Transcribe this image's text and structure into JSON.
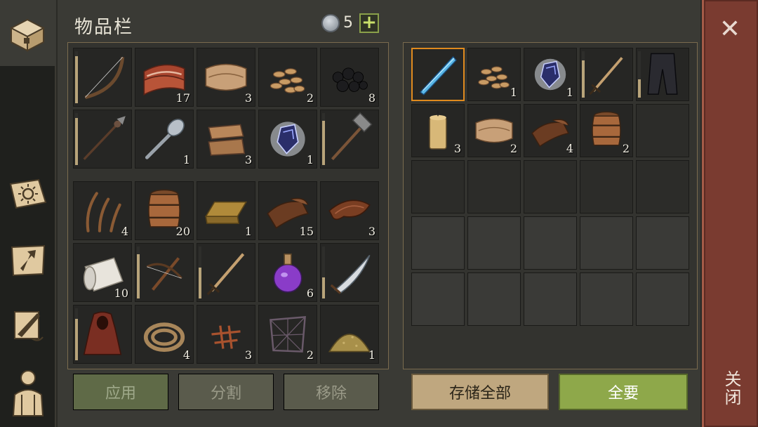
{
  "header": {
    "title": "物品栏",
    "currency_count": "5",
    "add_label": "+"
  },
  "sidebar": {
    "tabs": [
      {
        "name": "inventory",
        "icon": "chest-icon",
        "active": true
      },
      {
        "name": "daily",
        "icon": "sun-book-icon"
      },
      {
        "name": "build",
        "icon": "hammer-map-icon"
      },
      {
        "name": "quests",
        "icon": "scroll-quill-icon"
      },
      {
        "name": "character",
        "icon": "character-icon"
      }
    ]
  },
  "inventory": {
    "equipped": [
      {
        "item": "bow",
        "count": "",
        "durability": 0.9
      },
      {
        "item": "meat",
        "count": "17"
      },
      {
        "item": "cloth",
        "count": "3"
      },
      {
        "item": "seeds",
        "count": "2"
      },
      {
        "item": "coal",
        "count": "8"
      },
      {
        "item": "spear",
        "count": "",
        "durability": 0.9
      },
      {
        "item": "spoon",
        "count": "1"
      },
      {
        "item": "fabric-scraps",
        "count": "3"
      },
      {
        "item": "crystal",
        "count": "1"
      },
      {
        "item": "hammer",
        "count": "",
        "durability": 0.85
      }
    ],
    "bag": [
      {
        "item": "fiber",
        "count": "4"
      },
      {
        "item": "barrel",
        "count": "20"
      },
      {
        "item": "ingot",
        "count": "1"
      },
      {
        "item": "leather",
        "count": "15"
      },
      {
        "item": "leather-strip",
        "count": "3"
      },
      {
        "item": "paper-roll",
        "count": "10"
      },
      {
        "item": "crossbow",
        "count": "",
        "durability": 0.85
      },
      {
        "item": "sword",
        "count": "",
        "durability": 0.6
      },
      {
        "item": "potion",
        "count": "6"
      },
      {
        "item": "scimitar",
        "count": "",
        "durability": 0.4
      },
      {
        "item": "cloak",
        "count": "",
        "durability": 0.8
      },
      {
        "item": "rope",
        "count": "4"
      },
      {
        "item": "scraps",
        "count": "3"
      },
      {
        "item": "net",
        "count": "2"
      },
      {
        "item": "powder",
        "count": "1"
      }
    ],
    "buttons": {
      "apply": "应用",
      "split": "分割",
      "remove": "移除"
    }
  },
  "storage": {
    "slots": [
      {
        "item": "crystal-blade",
        "count": "",
        "selected": true
      },
      {
        "item": "seeds",
        "count": "1"
      },
      {
        "item": "crystal",
        "count": "1"
      },
      {
        "item": "sword",
        "count": "",
        "durability": 0.8
      },
      {
        "item": "pants",
        "count": "",
        "durability": 0.4
      },
      {
        "item": "candle",
        "count": "3"
      },
      {
        "item": "cloth",
        "count": "2"
      },
      {
        "item": "leather",
        "count": "4"
      },
      {
        "item": "barrel",
        "count": "2"
      }
    ],
    "buttons": {
      "store_all": "存储全部",
      "take_all": "全要"
    }
  },
  "close": {
    "label": "关闭",
    "x": "✕"
  },
  "colors": {
    "accent_green": "#8ea84a",
    "close_red": "#7a3b30",
    "selected_border": "#e08a1e"
  }
}
